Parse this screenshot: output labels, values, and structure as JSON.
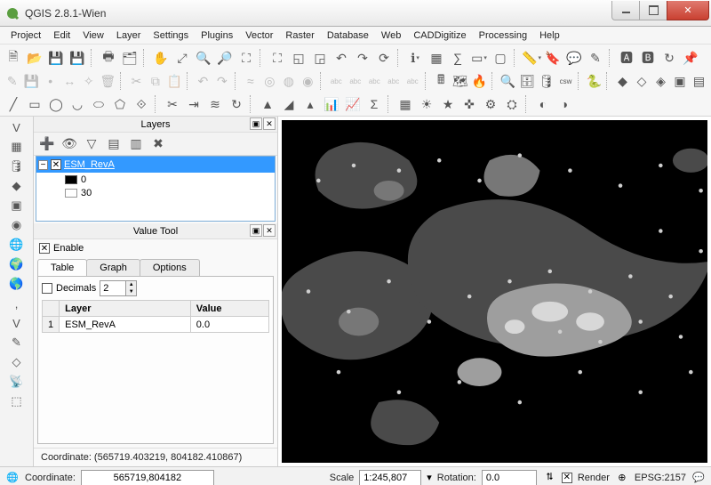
{
  "window": {
    "title": "QGIS 2.8.1-Wien"
  },
  "menu": [
    "Project",
    "Edit",
    "View",
    "Layer",
    "Settings",
    "Plugins",
    "Vector",
    "Raster",
    "Database",
    "Web",
    "CADDigitize",
    "Processing",
    "Help"
  ],
  "panels": {
    "layers": {
      "title": "Layers",
      "layer": {
        "name": "ESM_RevA",
        "checked": true,
        "expanded": true,
        "band_low": "0",
        "band_high": "30"
      }
    },
    "valuetool": {
      "title": "Value Tool",
      "enable_label": "Enable",
      "enable_checked": true,
      "tabs": [
        "Table",
        "Graph",
        "Options"
      ],
      "active_tab": 0,
      "decimals_label": "Decimals",
      "decimals_value": "2",
      "columns": [
        "Layer",
        "Value"
      ],
      "row_index": "1",
      "row_layer": "ESM_RevA",
      "row_value": "0.0"
    },
    "coord_readout": "Coordinate: (565719.403219, 804182.410867)"
  },
  "statusbar": {
    "coord_label": "Coordinate:",
    "coord_value": "565719,804182",
    "scale_label": "Scale",
    "scale_value": "1:245,807",
    "rotation_label": "Rotation:",
    "rotation_value": "0.0",
    "render_label": "Render",
    "render_checked": true,
    "crs": "EPSG:2157"
  }
}
